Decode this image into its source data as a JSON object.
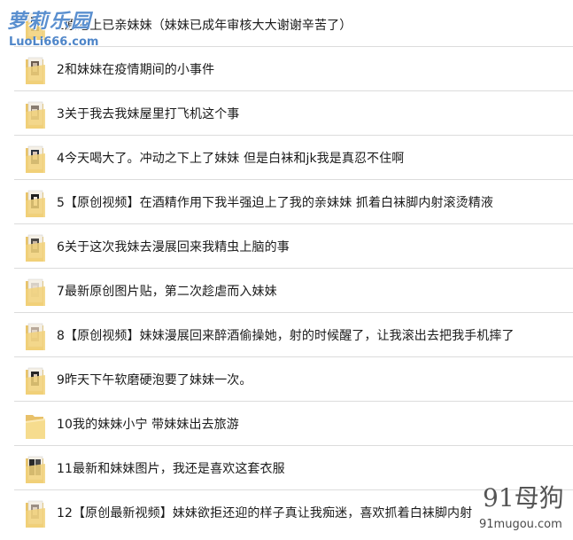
{
  "watermarks": {
    "top_left_logo": "萝莉乐园",
    "top_left_url": "LuoLi666.com",
    "bottom_right_logo": "91母狗",
    "bottom_right_url": "91mugou.com"
  },
  "items": [
    {
      "label": "1原睡上已亲妹妹（妹妹已成年审核大大谢谢辛苦了）",
      "icon": "folder-thumbnail-icon"
    },
    {
      "label": "2和妹妹在疫情期间的小事件",
      "icon": "folder-thumbnail-icon"
    },
    {
      "label": "3关于我去我妹屋里打飞机这个事",
      "icon": "folder-thumbnail-icon"
    },
    {
      "label": "4今天喝大了。冲动之下上了妹妹  但是白袜和jk我是真忍不住啊",
      "icon": "folder-thumbnail-icon"
    },
    {
      "label": "5【原创视频】在酒精作用下我半强迫上了我的亲妹妹  抓着白袜脚内射滚烫精液",
      "icon": "folder-thumbnail-icon"
    },
    {
      "label": "6关于这次我妹去漫展回来我精虫上脑的事",
      "icon": "folder-thumbnail-icon"
    },
    {
      "label": "7最新原创图片贴，第二次趁虐而入妹妹",
      "icon": "folder-thumbnail-icon"
    },
    {
      "label": "8【原创视频】妹妹漫展回来醉酒偷操她，射的时候醒了，让我滚出去把我手机摔了",
      "icon": "folder-thumbnail-icon"
    },
    {
      "label": "9昨天下午软磨硬泡要了妹妹一次。",
      "icon": "folder-thumbnail-icon"
    },
    {
      "label": "10我的妹妹小宁 带妹妹出去旅游",
      "icon": "folder-icon"
    },
    {
      "label": "11最新和妹妹图片，我还是喜欢这套衣服",
      "icon": "folder-thumbnail-icon"
    },
    {
      "label": "12【原创最新视频】妹妹欲拒还迎的样子真让我痴迷，喜欢抓着白袜脚内射",
      "icon": "folder-thumbnail-icon"
    }
  ]
}
